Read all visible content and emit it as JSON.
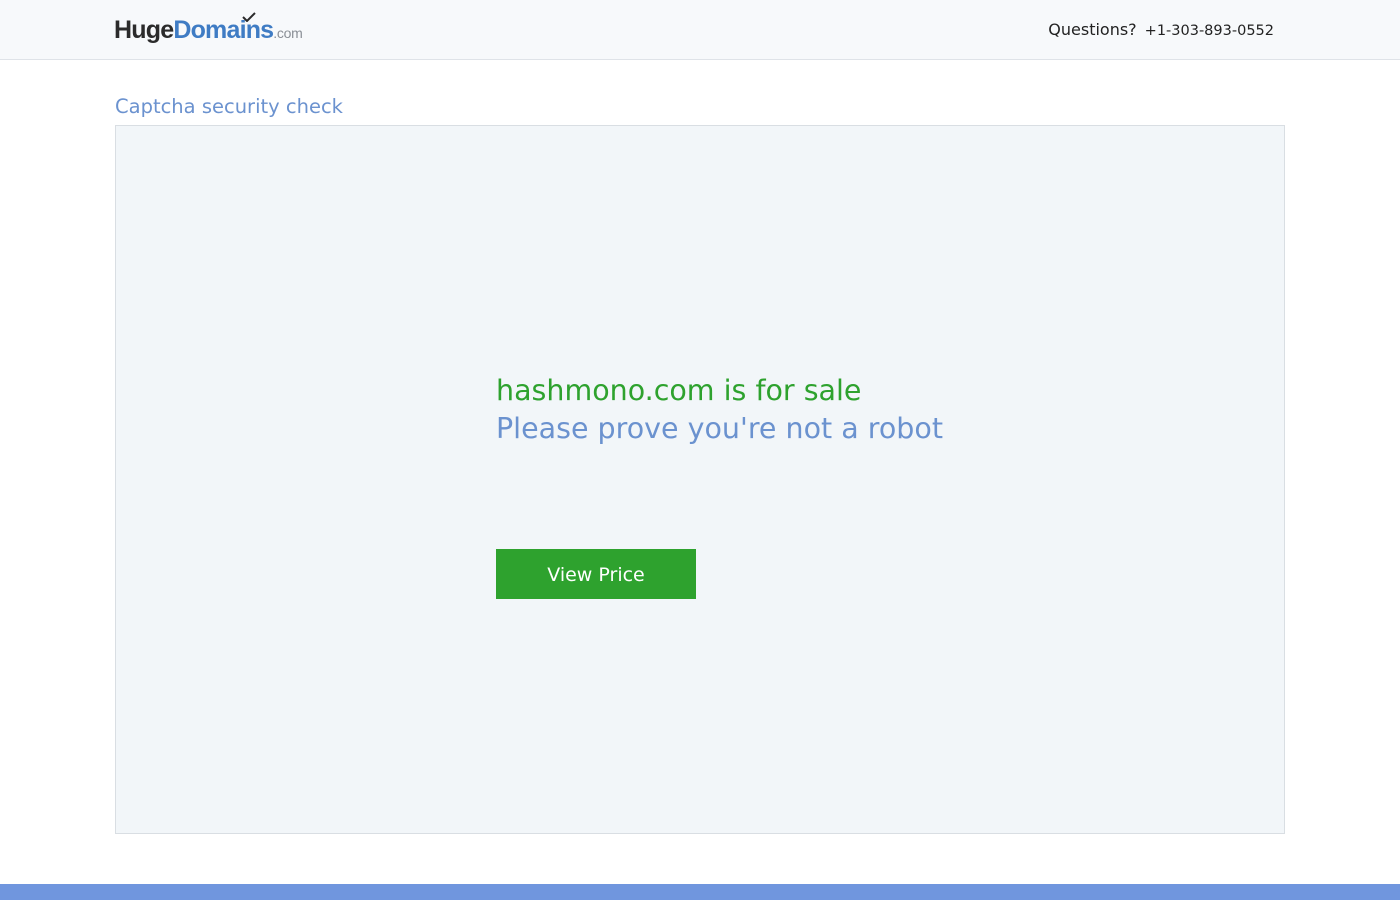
{
  "header": {
    "logo": {
      "part_huge": "Huge",
      "part_domains": "Domains",
      "part_com": ".com"
    },
    "contact_label": "Questions?",
    "contact_phone": "+1-303-893-0552"
  },
  "section_title": "Captcha security check",
  "panel": {
    "headline": "hashmono.com is for sale",
    "subline": "Please prove you're not a robot",
    "button_label": "View Price"
  },
  "colors": {
    "brand_blue": "#3f7cc4",
    "accent_green": "#2ea22e",
    "soft_blue": "#6b92cf",
    "footer_blue": "#7096de",
    "panel_bg": "#f2f6f9"
  }
}
